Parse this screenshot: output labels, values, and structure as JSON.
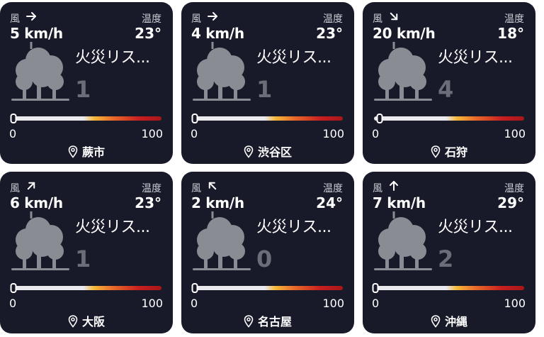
{
  "labels": {
    "wind": "風",
    "temp": "温度",
    "min": "0",
    "max": "100"
  },
  "cards": [
    {
      "wind_speed": "5 km/h",
      "wind_direction": "east",
      "temp": "23°",
      "risk_title": "火災リス...",
      "risk_level": "1",
      "risk_fraction": 0.0,
      "location": "蕨市"
    },
    {
      "wind_speed": "4 km/h",
      "wind_direction": "east",
      "temp": "23°",
      "risk_title": "火災リス...",
      "risk_level": "1",
      "risk_fraction": 0.0,
      "location": "渋谷区"
    },
    {
      "wind_speed": "20 km/h",
      "wind_direction": "south-east",
      "temp": "18°",
      "risk_title": "火災リス...",
      "risk_level": "4",
      "risk_fraction": 0.04,
      "location": "石狩"
    },
    {
      "wind_speed": "6 km/h",
      "wind_direction": "north-east",
      "temp": "23°",
      "risk_title": "火災リス...",
      "risk_level": "1",
      "risk_fraction": 0.0,
      "location": "大阪"
    },
    {
      "wind_speed": "2 km/h",
      "wind_direction": "north-west",
      "temp": "24°",
      "risk_title": "火災リス...",
      "risk_level": "0",
      "risk_fraction": 0.0,
      "location": "名古屋"
    },
    {
      "wind_speed": "7 km/h",
      "wind_direction": "north",
      "temp": "29°",
      "risk_title": "火災リス...",
      "risk_level": "2",
      "risk_fraction": 0.01,
      "location": "沖縄"
    }
  ]
}
